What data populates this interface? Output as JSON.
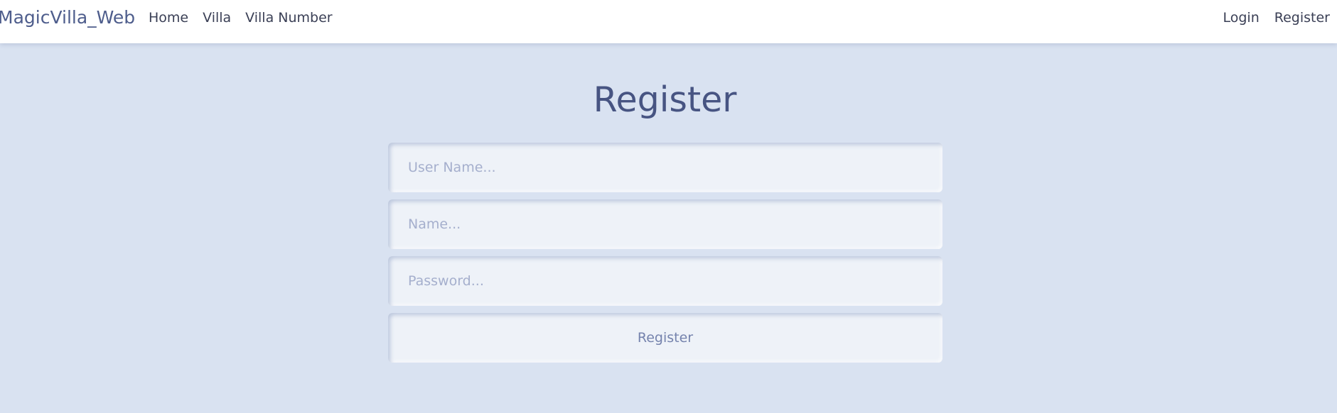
{
  "navbar": {
    "brand": "MagicVilla_Web",
    "left_links": [
      {
        "label": "Home"
      },
      {
        "label": "Villa"
      },
      {
        "label": "Villa Number"
      }
    ],
    "right_links": [
      {
        "label": "Login"
      },
      {
        "label": "Register"
      }
    ]
  },
  "page": {
    "title": "Register"
  },
  "form": {
    "username": {
      "placeholder": "User Name...",
      "value": ""
    },
    "name": {
      "placeholder": "Name...",
      "value": ""
    },
    "password": {
      "placeholder": "Password...",
      "value": ""
    },
    "submit_label": "Register"
  },
  "colors": {
    "background": "#d9e2f1",
    "navbar": "#ffffff",
    "brand": "#4e5d8c",
    "title": "#475482",
    "input_bg": "#eef2f8",
    "placeholder": "#a5afcd"
  }
}
